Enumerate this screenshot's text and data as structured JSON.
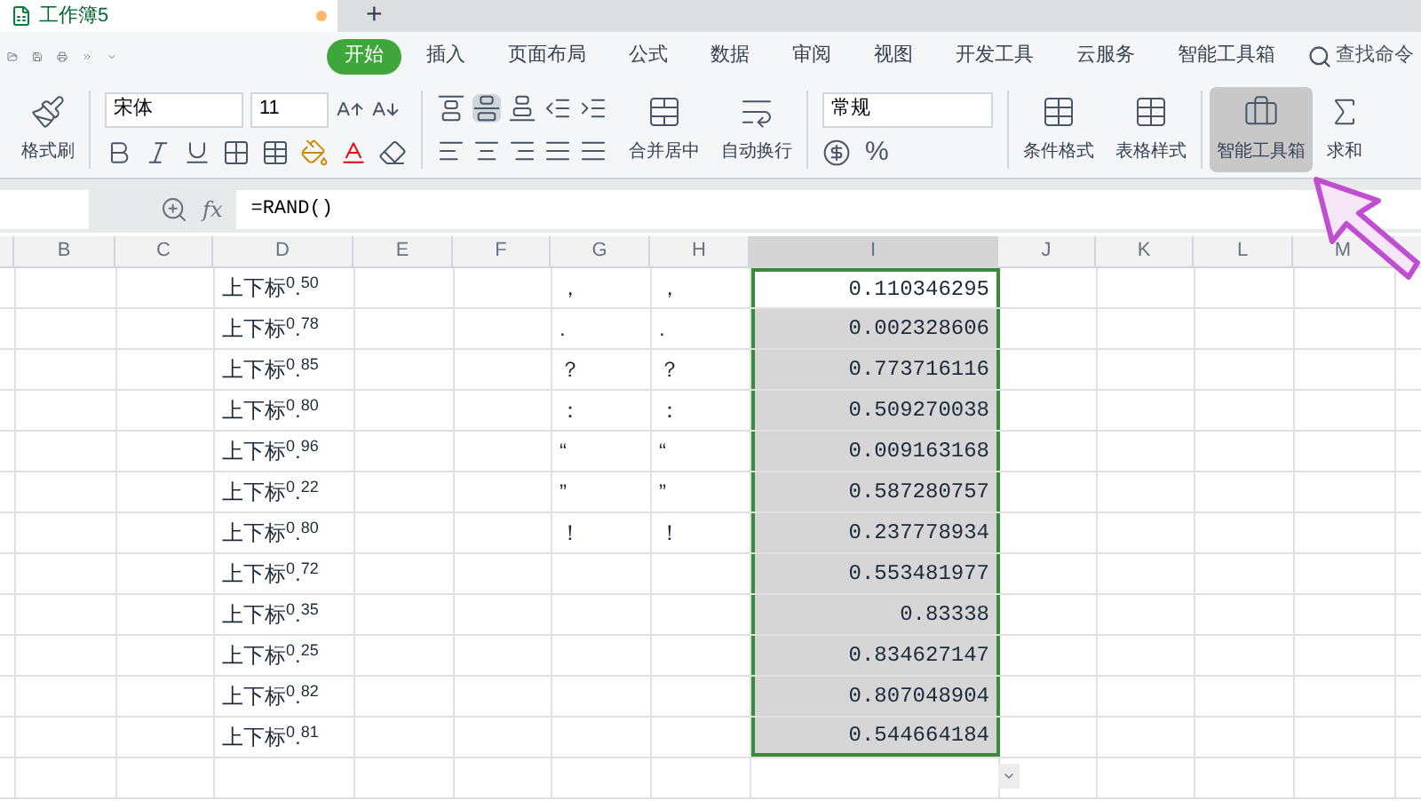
{
  "doc_tab": {
    "title": "工作簿5",
    "new_tab": "+"
  },
  "ribbon_tabs": [
    {
      "label": "开始",
      "selected": true
    },
    {
      "label": "插入",
      "selected": false
    },
    {
      "label": "页面布局",
      "selected": false
    },
    {
      "label": "公式",
      "selected": false
    },
    {
      "label": "数据",
      "selected": false
    },
    {
      "label": "审阅",
      "selected": false
    },
    {
      "label": "视图",
      "selected": false
    },
    {
      "label": "开发工具",
      "selected": false
    },
    {
      "label": "云服务",
      "selected": false
    },
    {
      "label": "智能工具箱",
      "selected": false
    }
  ],
  "search": {
    "placeholder": "查找命令"
  },
  "ribbon": {
    "format_painter": "格式刷",
    "font_name": "宋体",
    "font_size": "11",
    "merge": "合并居中",
    "wrap": "自动换行",
    "number_format": "常规",
    "percent": "%",
    "conditional": "条件格式",
    "table_style": "表格样式",
    "toolbox": {
      "label": "智能工具箱",
      "highlighted": true
    },
    "sum": "求和"
  },
  "formula_bar": {
    "fx": "fx",
    "formula": "=RAND()"
  },
  "columns": [
    {
      "label": "B",
      "selected": false
    },
    {
      "label": "C",
      "selected": false
    },
    {
      "label": "D",
      "selected": false
    },
    {
      "label": "E",
      "selected": false
    },
    {
      "label": "F",
      "selected": false
    },
    {
      "label": "G",
      "selected": false
    },
    {
      "label": "H",
      "selected": false
    },
    {
      "label": "I",
      "selected": true
    },
    {
      "label": "J",
      "selected": false
    },
    {
      "label": "K",
      "selected": false
    },
    {
      "label": "L",
      "selected": false
    },
    {
      "label": "M",
      "selected": false
    }
  ],
  "rows": [
    {
      "d": "上下标$^{0}$.$^{50}$",
      "g": "，",
      "h": "，",
      "i": "0.110346295",
      "selected": true,
      "active": true
    },
    {
      "d": "上下标$^{0}$.$^{78}$",
      "g": ".",
      "h": ".",
      "i": "0.002328606",
      "selected": true,
      "active": false
    },
    {
      "d": "上下标$^{0}$.$^{85}$",
      "g": "？",
      "h": "？",
      "i": "0.773716116",
      "selected": true,
      "active": false
    },
    {
      "d": "上下标$^{0}$.$^{80}$",
      "g": "：",
      "h": "：",
      "i": "0.509270038",
      "selected": true,
      "active": false
    },
    {
      "d": "上下标$^{0}$.$^{96}$",
      "g": "“",
      "h": "“",
      "i": "0.009163168",
      "selected": true,
      "active": false
    },
    {
      "d": "上下标$^{0}$.$^{22}$",
      "g": "”",
      "h": "”",
      "i": "0.587280757",
      "selected": true,
      "active": false
    },
    {
      "d": "上下标$^{0}$.$^{80}$",
      "g": "！",
      "h": "！",
      "i": "0.237778934",
      "selected": true,
      "active": false
    },
    {
      "d": "上下标$^{0}$.$^{72}$",
      "i": "0.553481977",
      "selected": true,
      "active": false
    },
    {
      "d": "上下标$^{0}$.$^{35}$",
      "i": "0.83338",
      "selected": true,
      "active": false
    },
    {
      "d": "上下标$^{0}$.$^{25}$",
      "i": "0.834627147",
      "selected": true,
      "active": false
    },
    {
      "d": "上下标$^{0}$.$^{82}$",
      "i": "0.807048904",
      "selected": true,
      "active": false
    },
    {
      "d": "上下标$^{0}$.$^{81}$",
      "i": "0.544664184",
      "selected": true,
      "active": false
    },
    {
      "selected": false
    }
  ]
}
